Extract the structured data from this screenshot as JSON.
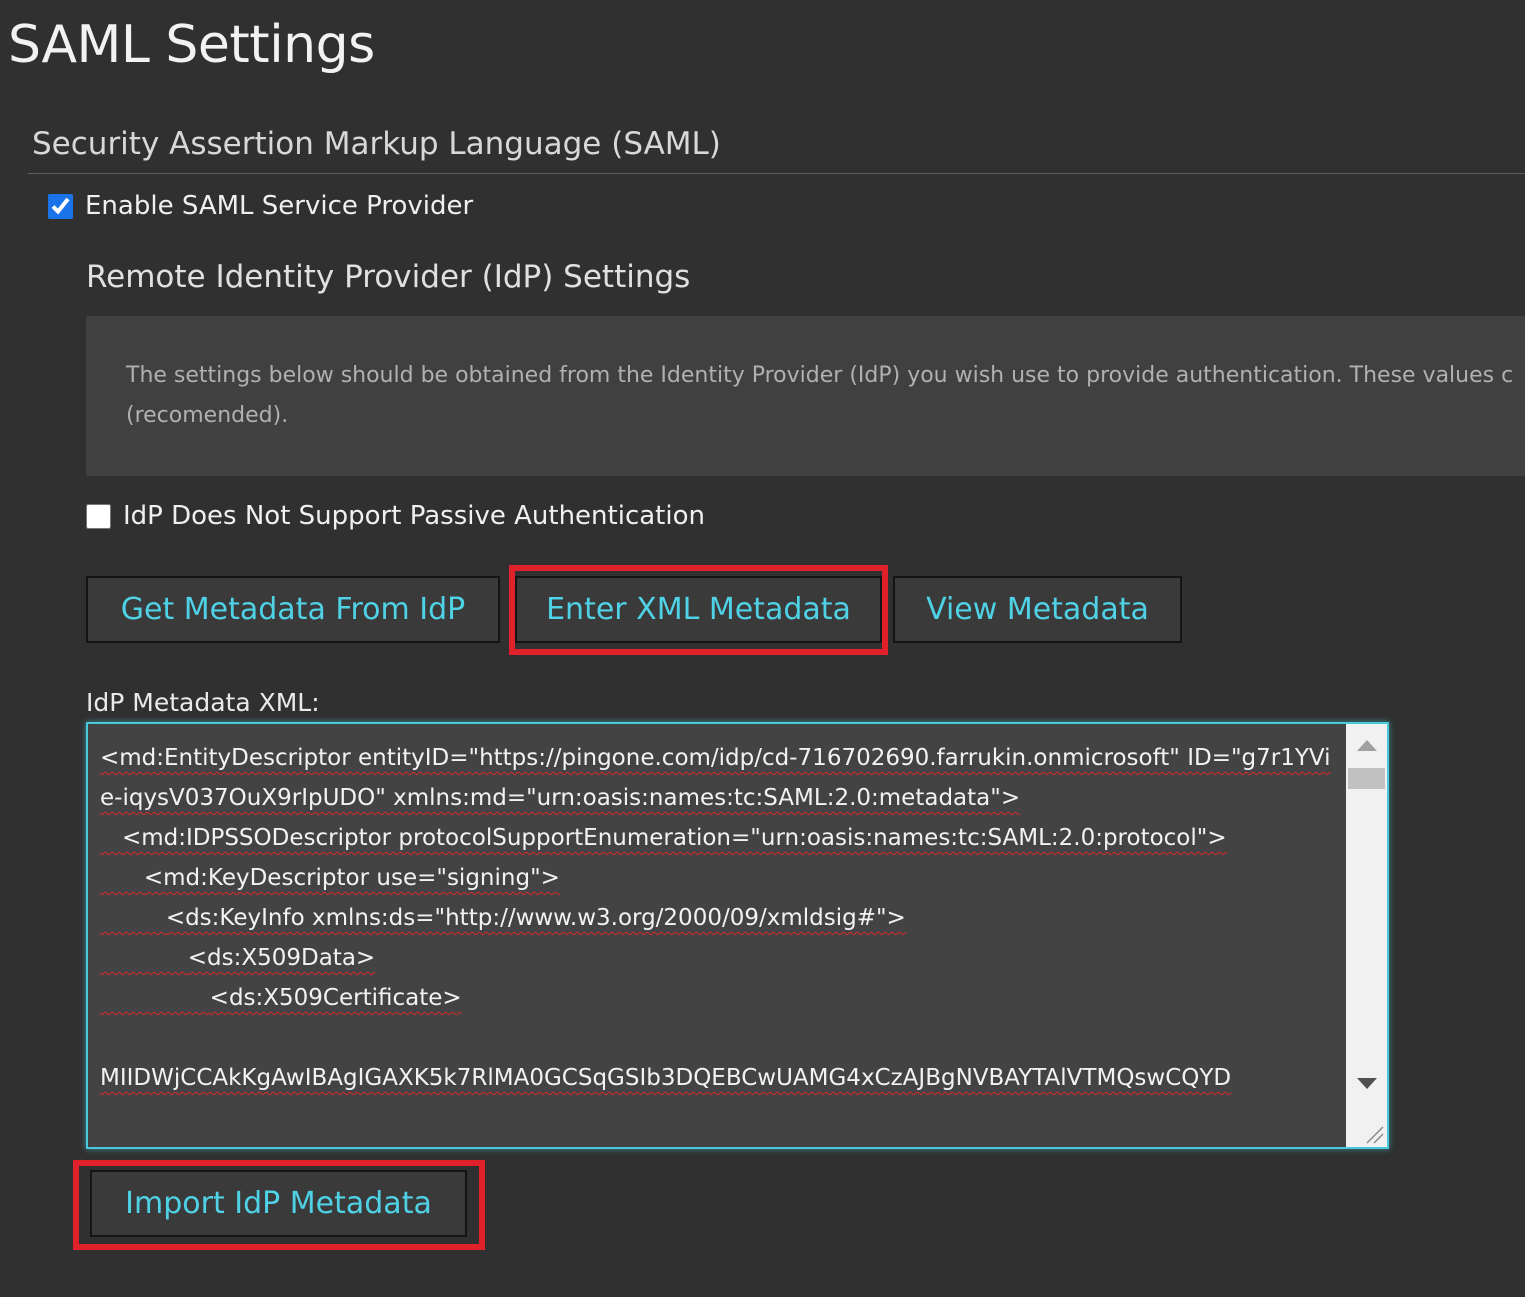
{
  "page": {
    "title": "SAML Settings"
  },
  "saml_section": {
    "title": "Security Assertion Markup Language (SAML)",
    "enable_label": "Enable SAML Service Provider",
    "enable_checked": true
  },
  "idp_section": {
    "title": "Remote Identity Provider (IdP) Settings",
    "info_text": "The settings below should be obtained from the Identity Provider (IdP) you wish use to provide authentication. These values c (recomended).",
    "passive_label": "IdP Does Not Support Passive Authentication",
    "passive_checked": false
  },
  "buttons": {
    "get_metadata": "Get Metadata From IdP",
    "enter_xml": "Enter XML Metadata",
    "view_metadata": "View Metadata",
    "import_metadata": "Import IdP Metadata"
  },
  "metadata_field": {
    "label": "IdP Metadata XML:",
    "value": "<md:EntityDescriptor entityID=\"https://pingone.com/idp/cd-716702690.farrukin.onmicrosoft\" ID=\"g7r1YVie-iqysV037OuX9rIpUDO\" xmlns:md=\"urn:oasis:names:tc:SAML:2.0:metadata\">\n   <md:IDPSSODescriptor protocolSupportEnumeration=\"urn:oasis:names:tc:SAML:2.0:protocol\">\n      <md:KeyDescriptor use=\"signing\">\n         <ds:KeyInfo xmlns:ds=\"http://www.w3.org/2000/09/xmldsig#\">\n            <ds:X509Data>\n               <ds:X509Certificate>\n\nMIIDWjCCAkKgAwIBAgIGAXK5k7RlMA0GCSqGSIb3DQEBCwUAMG4xCzAJBgNVBAYTAlVTMQswCQYD"
  },
  "colors": {
    "background": "#303030",
    "button_text": "#4fd2e6",
    "highlight": "#e0202a",
    "field_border": "#49c9dc"
  }
}
